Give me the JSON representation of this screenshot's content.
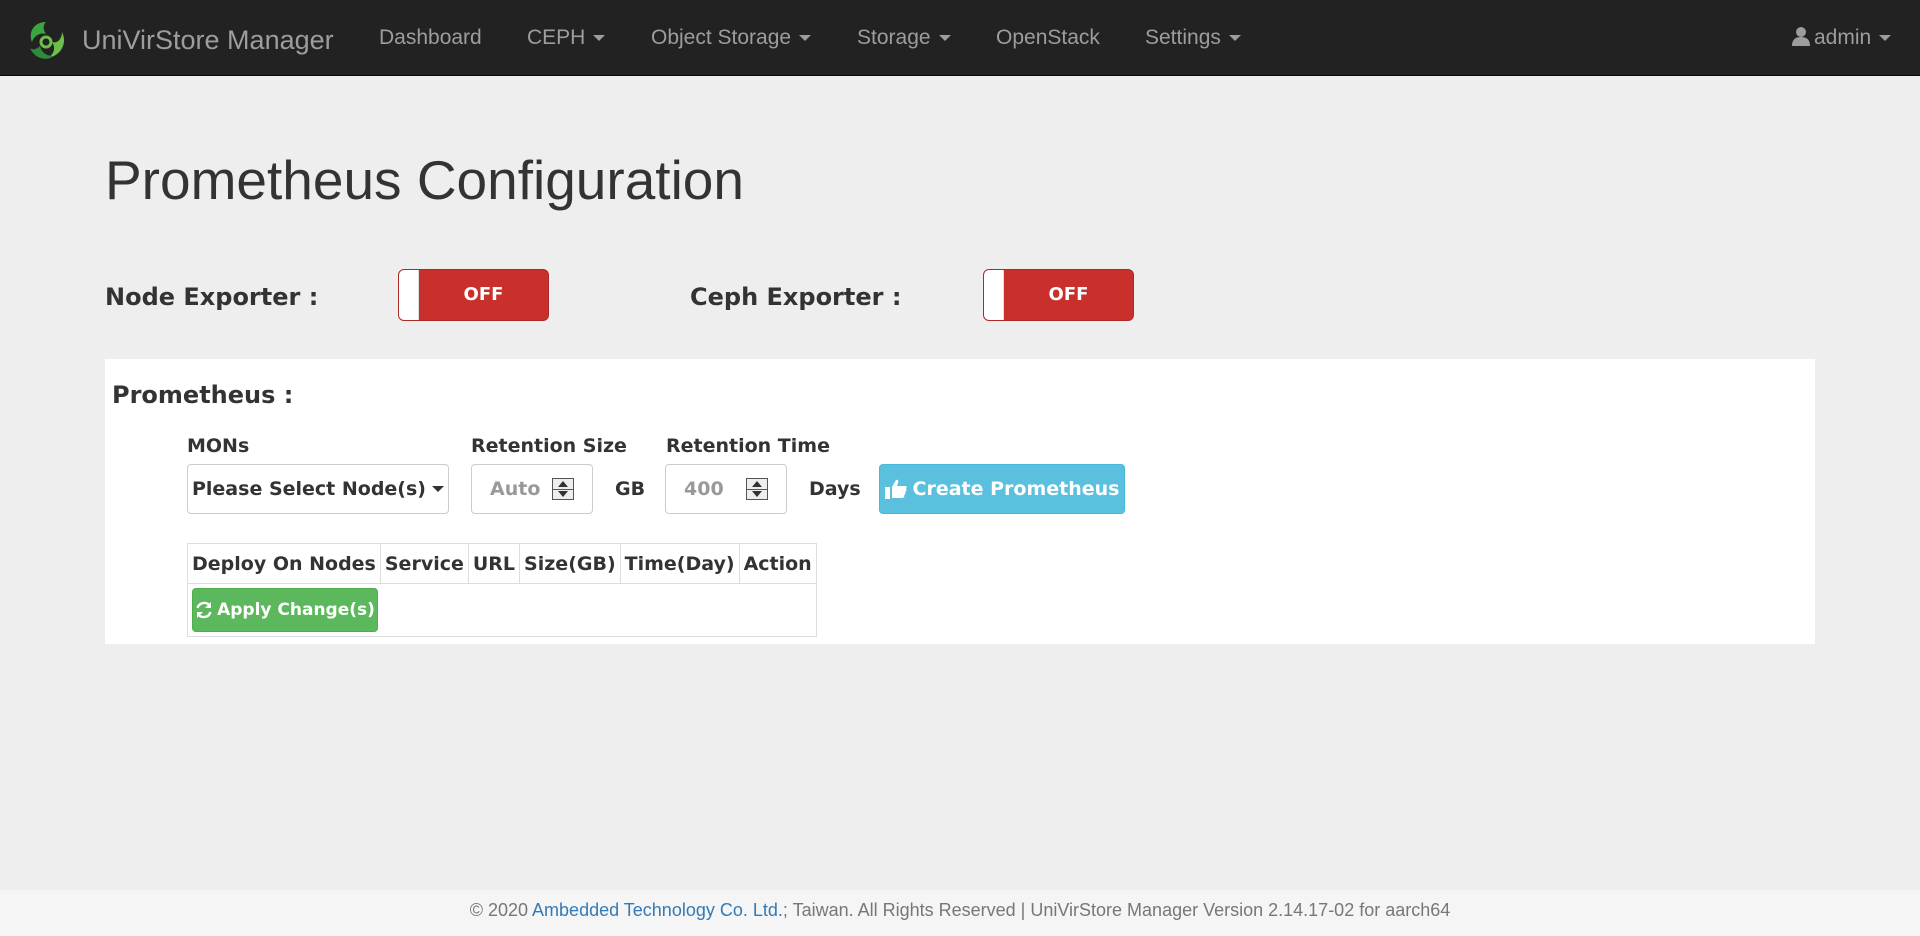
{
  "brand": {
    "name": "UniVirStore Manager"
  },
  "nav": {
    "dashboard": "Dashboard",
    "ceph": "CEPH",
    "object_storage": "Object Storage",
    "storage": "Storage",
    "openstack": "OpenStack",
    "settings": "Settings",
    "user": "admin"
  },
  "page": {
    "title": "Prometheus Configuration"
  },
  "exporters": {
    "node_label": "Node Exporter :",
    "node_state": "OFF",
    "ceph_label": "Ceph Exporter :",
    "ceph_state": "OFF"
  },
  "prometheus": {
    "heading": "Prometheus :",
    "mons_label": "MONs",
    "mons_select": "Please Select Node(s)",
    "retention_size_label": "Retention Size",
    "retention_size_value": "Auto",
    "size_unit": "GB",
    "retention_time_label": "Retention Time",
    "retention_time_value": "400",
    "time_unit": "Days",
    "create_button": "Create Prometheus"
  },
  "table": {
    "columns": [
      "Deploy On Nodes",
      "Service",
      "URL",
      "Size(GB)",
      "Time(Day)",
      "Action"
    ],
    "apply_button": "Apply Change(s)"
  },
  "footer": {
    "prefix": "© 2020 ",
    "company": "Ambedded Technology Co. Ltd.",
    "suffix": "; Taiwan. All Rights Reserved | UniVirStore Manager Version 2.14.17-02 for aarch64"
  },
  "colors": {
    "navbar": "#222222",
    "toggle_off": "#c9302c",
    "info_button": "#5bc0de",
    "success_button": "#5cb85c",
    "link": "#337ab7"
  }
}
